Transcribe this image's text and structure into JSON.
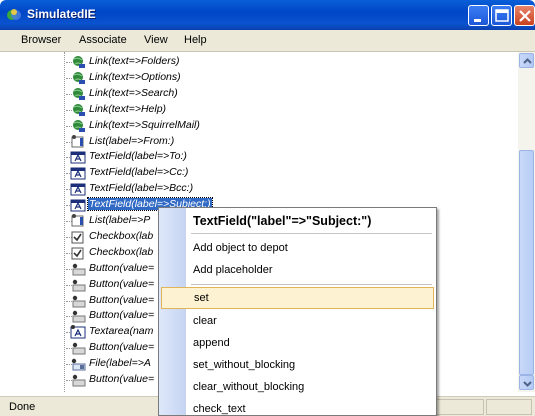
{
  "window": {
    "title": "SimulatedIE",
    "min_icon": "minimize-icon",
    "max_icon": "maximize-icon",
    "close_icon": "close-icon"
  },
  "menubar": {
    "items": [
      "Browser",
      "Associate",
      "View",
      "Help"
    ]
  },
  "tree": {
    "rows": [
      {
        "label": "Link(text=>Folders)",
        "icon": "link-icon"
      },
      {
        "label": "Link(text=>Options)",
        "icon": "link-icon"
      },
      {
        "label": "Link(text=>Search)",
        "icon": "link-icon"
      },
      {
        "label": "Link(text=>Help)",
        "icon": "link-icon"
      },
      {
        "label": "Link(text=>SquirrelMail)",
        "icon": "link-icon"
      },
      {
        "label": "List(label=>From:)",
        "icon": "list-icon"
      },
      {
        "label": "TextField(label=>To:)",
        "icon": "textfield-icon"
      },
      {
        "label": "TextField(label=>Cc:)",
        "icon": "textfield-icon"
      },
      {
        "label": "TextField(label=>Bcc:)",
        "icon": "textfield-icon"
      },
      {
        "label": "TextField(label=>Subject:)",
        "icon": "textfield-icon",
        "selected": true
      },
      {
        "label": "List(label=>P",
        "icon": "list-icon"
      },
      {
        "label": "Checkbox(lab",
        "icon": "checkbox-icon"
      },
      {
        "label": "Checkbox(lab",
        "icon": "checkbox-icon"
      },
      {
        "label": "Button(value=",
        "icon": "button-icon"
      },
      {
        "label": "Button(value=",
        "icon": "button-icon"
      },
      {
        "label": "Button(value=",
        "icon": "button-icon"
      },
      {
        "label": "Button(value=",
        "icon": "button-icon"
      },
      {
        "label": "Textarea(nam",
        "icon": "textarea-icon"
      },
      {
        "label": "Button(value=",
        "icon": "button-icon"
      },
      {
        "label": "File(label=>A",
        "icon": "file-icon"
      },
      {
        "label": "Button(value=",
        "icon": "button-icon"
      }
    ]
  },
  "context_menu": {
    "title": "TextField(\"label\"=>\"Subject:\")",
    "group1": [
      "Add object to depot",
      "Add placeholder"
    ],
    "group2": [
      "set",
      "clear",
      "append",
      "set_without_blocking",
      "clear_without_blocking",
      "check_text"
    ],
    "hovered": "set"
  },
  "statusbar": {
    "text": "Done"
  },
  "colors": {
    "titlebar": "#0046c7",
    "selection": "#316ac5",
    "menu_hover": "#fdf3d2"
  }
}
